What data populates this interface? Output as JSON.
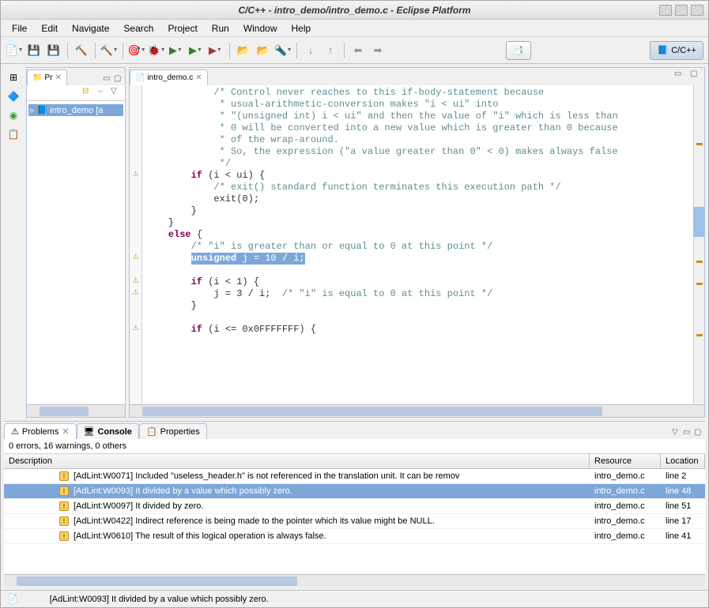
{
  "title": "C/C++ - intro_demo/intro_demo.c - Eclipse Platform",
  "menu": [
    "File",
    "Edit",
    "Navigate",
    "Search",
    "Project",
    "Run",
    "Window",
    "Help"
  ],
  "perspective": {
    "label": "C/C++"
  },
  "project_explorer": {
    "tab_label": "Pr",
    "root": "intro_demo [a"
  },
  "editor": {
    "tab_label": "intro_demo.c",
    "code_lines": [
      {
        "indent": 12,
        "type": "comment",
        "text": "/* Control never reaches to this if-body-statement because"
      },
      {
        "indent": 12,
        "type": "comment",
        "text": " * usual-arithmetic-conversion makes \"i < ui\" into"
      },
      {
        "indent": 12,
        "type": "comment",
        "text": " * \"(unsigned int) i < ui\" and then the value of \"i\" which is less than"
      },
      {
        "indent": 12,
        "type": "comment",
        "text": " * 0 will be converted into a new value which is greater than 0 because"
      },
      {
        "indent": 12,
        "type": "comment",
        "text": " * of the wrap-around."
      },
      {
        "indent": 12,
        "type": "comment",
        "text": " * So, the expression (\"a value greater than 0\" < 0) makes always false"
      },
      {
        "indent": 12,
        "type": "comment",
        "text": " */"
      },
      {
        "indent": 8,
        "type": "code",
        "parts": [
          {
            "k": 1,
            "t": "if"
          },
          {
            "k": 0,
            "t": " (i < ui) {"
          }
        ],
        "warn": true
      },
      {
        "indent": 12,
        "type": "comment",
        "text": "/* exit() standard function terminates this execution path */"
      },
      {
        "indent": 12,
        "type": "code",
        "parts": [
          {
            "k": 0,
            "t": "exit(0);"
          }
        ]
      },
      {
        "indent": 8,
        "type": "code",
        "parts": [
          {
            "k": 0,
            "t": "}"
          }
        ]
      },
      {
        "indent": 4,
        "type": "code",
        "parts": [
          {
            "k": 0,
            "t": "}"
          }
        ]
      },
      {
        "indent": 4,
        "type": "code",
        "parts": [
          {
            "k": 1,
            "t": "else"
          },
          {
            "k": 0,
            "t": " {"
          }
        ]
      },
      {
        "indent": 8,
        "type": "comment",
        "text": "/* \"i\" is greater than or equal to 0 at this point */"
      },
      {
        "indent": 8,
        "type": "hl",
        "parts": [
          {
            "k": 1,
            "t": "unsigned"
          },
          {
            "k": 0,
            "t": " j = 10 / i;"
          }
        ],
        "warn": true
      },
      {
        "indent": 0,
        "type": "blank"
      },
      {
        "indent": 8,
        "type": "code",
        "parts": [
          {
            "k": 1,
            "t": "if"
          },
          {
            "k": 0,
            "t": " (i < 1) {"
          }
        ],
        "warn": true
      },
      {
        "indent": 12,
        "type": "code",
        "parts": [
          {
            "k": 0,
            "t": "j = 3 / i;  "
          },
          {
            "k": 2,
            "t": "/* \"i\" is equal to 0 at this point */"
          }
        ],
        "warn": true
      },
      {
        "indent": 8,
        "type": "code",
        "parts": [
          {
            "k": 0,
            "t": "}"
          }
        ]
      },
      {
        "indent": 0,
        "type": "blank"
      },
      {
        "indent": 8,
        "type": "code",
        "parts": [
          {
            "k": 1,
            "t": "if"
          },
          {
            "k": 0,
            "t": " (i <= 0x0FFFFFFF) {"
          }
        ],
        "warn": true
      }
    ]
  },
  "problems": {
    "tab_problems": "Problems",
    "tab_console": "Console",
    "tab_properties": "Properties",
    "summary": "0 errors, 16 warnings, 0 others",
    "columns": {
      "desc": "Description",
      "res": "Resource",
      "loc": "Location"
    },
    "rows": [
      {
        "desc": "[AdLint:W0071] Included \"useless_header.h\" is not referenced in the translation unit. It can be remov",
        "res": "intro_demo.c",
        "loc": "line 2"
      },
      {
        "desc": "[AdLint:W0093] It divided by a value which possibly zero.",
        "res": "intro_demo.c",
        "loc": "line 48",
        "sel": true
      },
      {
        "desc": "[AdLint:W0097] It divided by zero.",
        "res": "intro_demo.c",
        "loc": "line 51"
      },
      {
        "desc": "[AdLint:W0422] Indirect reference is being made to the pointer which its value might be NULL.",
        "res": "intro_demo.c",
        "loc": "line 17"
      },
      {
        "desc": "[AdLint:W0610] The result of this logical operation is always false.",
        "res": "intro_demo.c",
        "loc": "line 41"
      }
    ]
  },
  "status": "[AdLint:W0093] It divided by a value which possibly zero."
}
